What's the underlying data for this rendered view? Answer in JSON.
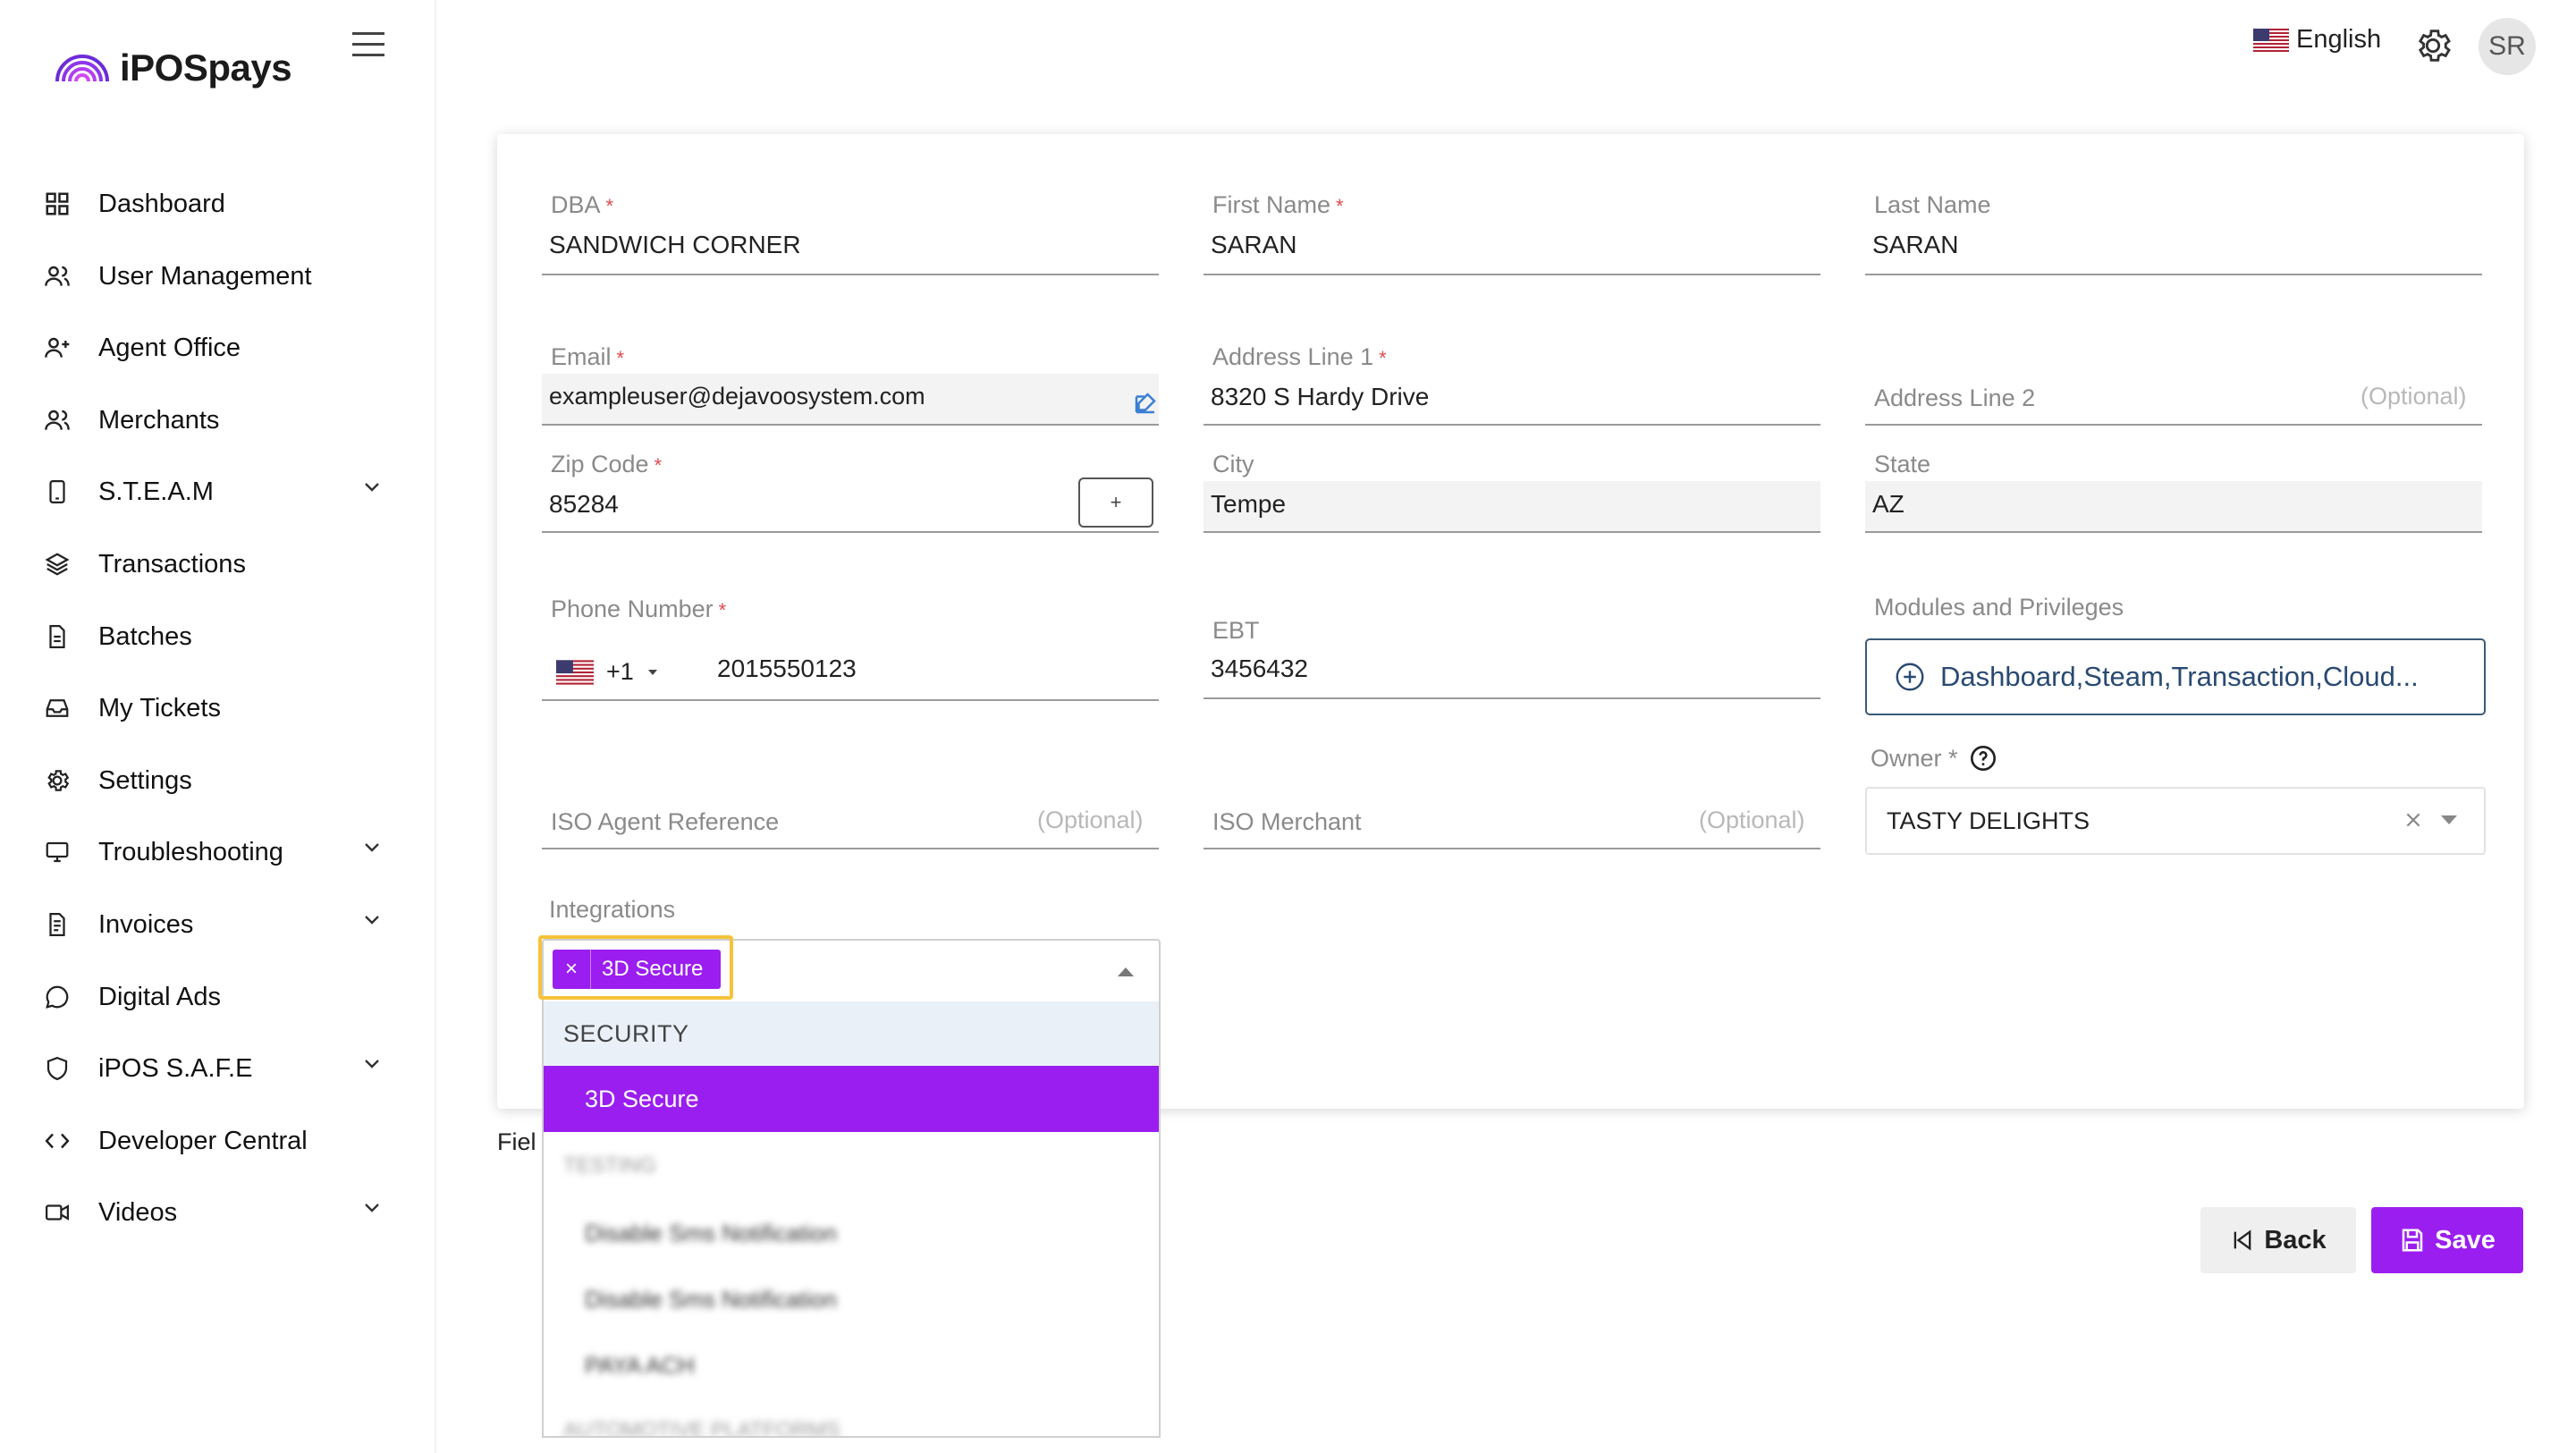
{
  "brand": {
    "name": "iPOSpays"
  },
  "sidebar": {
    "items": [
      {
        "label": "Dashboard",
        "icon": "grid-icon",
        "expandable": false
      },
      {
        "label": "User Management",
        "icon": "users-icon",
        "expandable": false
      },
      {
        "label": "Agent Office",
        "icon": "user-plus-icon",
        "expandable": false
      },
      {
        "label": "Merchants",
        "icon": "users-icon",
        "expandable": false
      },
      {
        "label": "S.T.E.A.M",
        "icon": "device-icon",
        "expandable": true
      },
      {
        "label": "Transactions",
        "icon": "layers-icon",
        "expandable": false
      },
      {
        "label": "Batches",
        "icon": "document-icon",
        "expandable": false
      },
      {
        "label": "My Tickets",
        "icon": "inbox-icon",
        "expandable": false
      },
      {
        "label": "Settings",
        "icon": "gear-icon",
        "expandable": false
      },
      {
        "label": "Troubleshooting",
        "icon": "monitor-icon",
        "expandable": true
      },
      {
        "label": "Invoices",
        "icon": "invoice-icon",
        "expandable": true
      },
      {
        "label": "Digital Ads",
        "icon": "chat-icon",
        "expandable": false
      },
      {
        "label": "iPOS S.A.F.E",
        "icon": "shield-icon",
        "expandable": true
      },
      {
        "label": "Developer Central",
        "icon": "code-icon",
        "expandable": false
      },
      {
        "label": "Videos",
        "icon": "video-icon",
        "expandable": true
      }
    ]
  },
  "header": {
    "language": "English",
    "avatar_initials": "SR"
  },
  "form": {
    "dba": {
      "label": "DBA",
      "value": "SANDWICH CORNER"
    },
    "first_name": {
      "label": "First Name",
      "value": "SARAN"
    },
    "last_name": {
      "label": "Last Name",
      "value": "SARAN"
    },
    "email": {
      "label": "Email",
      "value": "exampleuser@dejavoosystem.com"
    },
    "address1": {
      "label": "Address Line 1",
      "value": "8320 S Hardy Drive"
    },
    "address2": {
      "label": "Address Line 2",
      "optional": "(Optional)"
    },
    "zip": {
      "label": "Zip Code",
      "value": "85284",
      "button": "+"
    },
    "city": {
      "label": "City",
      "value": "Tempe"
    },
    "state": {
      "label": "State",
      "value": "AZ"
    },
    "phone": {
      "label": "Phone Number",
      "country_code": "+1",
      "value": "2015550123"
    },
    "ebt": {
      "label": "EBT",
      "value": "3456432"
    },
    "modules": {
      "label": "Modules and Privileges",
      "value": "Dashboard,Steam,Transaction,Cloud..."
    },
    "owner": {
      "label": "Owner *",
      "value": "TASTY DELIGHTS"
    },
    "iso_agent": {
      "label": "ISO Agent Reference",
      "optional": "(Optional)"
    },
    "iso_merchant": {
      "label": "ISO Merchant",
      "optional": "(Optional)"
    },
    "integrations": {
      "label": "Integrations",
      "selected_chip": "3D Secure",
      "chip_remove": "×",
      "groups": [
        {
          "name": "SECURITY",
          "options": [
            "3D Secure"
          ]
        },
        {
          "name": "TESTING",
          "options": [
            "Disable Sms Notification",
            "Disable Sms Notification",
            "PAYA ACH"
          ]
        },
        {
          "name": "AUTOMOTIVE PLATFORMS",
          "options": []
        }
      ]
    },
    "required_marker": "*"
  },
  "footer": {
    "field_note": "Fiel",
    "back": "Back",
    "save": "Save"
  },
  "colors": {
    "accent": "#9b1ef0",
    "highlight": "#f5c33b",
    "required": "#e0494d"
  }
}
